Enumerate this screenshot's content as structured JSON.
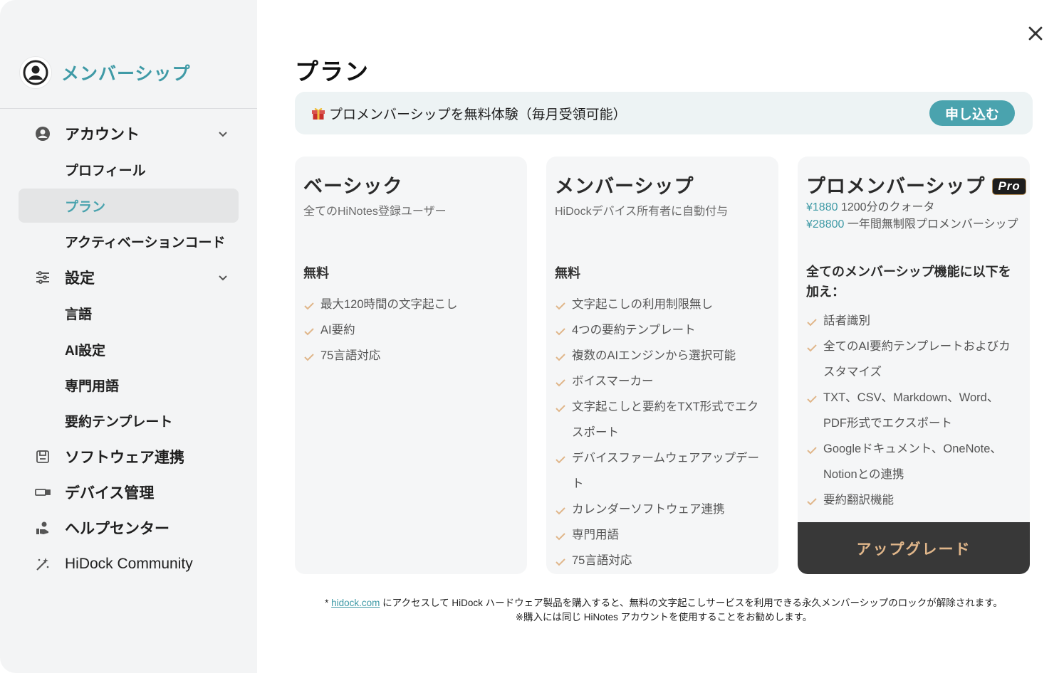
{
  "sidebar": {
    "title": "メンバーシップ",
    "items": [
      {
        "label": "アカウント"
      },
      {
        "label": "プロフィール"
      },
      {
        "label": "プラン"
      },
      {
        "label": "アクティベーションコード"
      },
      {
        "label": "設定"
      },
      {
        "label": "言語"
      },
      {
        "label": "AI設定"
      },
      {
        "label": "専門用語"
      },
      {
        "label": "要約テンプレート"
      },
      {
        "label": "ソフトウェア連携"
      },
      {
        "label": "デバイス管理"
      },
      {
        "label": "ヘルプセンター"
      },
      {
        "label": "HiDock Community"
      }
    ]
  },
  "main": {
    "title": "プラン",
    "banner": {
      "text": "プロメンバーシップを無料体験（毎月受領可能）",
      "button": "申し込む"
    },
    "plans": [
      {
        "name": "ベーシック",
        "subtitle": "全てのHiNotes登録ユーザー",
        "price": "無料",
        "features": [
          "最大120時間の文字起こし",
          "AI要約",
          "75言語対応"
        ]
      },
      {
        "name": "メンバーシップ",
        "subtitle": "HiDockデバイス所有者に自動付与",
        "price": "無料",
        "features": [
          "文字起こしの利用制限無し",
          "4つの要約テンプレート",
          "複数のAIエンジンから選択可能",
          "ボイスマーカー",
          "文字起こしと要約をTXT形式でエクスポート",
          "デバイスファームウェアアップデート",
          "カレンダーソフトウェア連携",
          "専門用語",
          "75言語対応"
        ]
      },
      {
        "name": "プロメンバーシップ",
        "badge": "Pro",
        "price1": "¥1880",
        "price1_desc": " 1200分のクォータ",
        "price2": "¥28800",
        "price2_desc": " 一年間無制限プロメンバーシップ",
        "lead": "全てのメンバーシップ機能に以下を加え：",
        "features": [
          "話者識別",
          "全てのAI要約テンプレートおよびカスタマイズ",
          "TXT、CSV、Markdown、Word、PDF形式でエクスポート",
          "Googleドキュメント、OneNote、Notionとの連携",
          "要約翻訳機能"
        ],
        "button": "アップグレード"
      }
    ],
    "footnote": {
      "prefix": "* ",
      "link": "hidock.com",
      "line1": " にアクセスして HiDock ハードウェア製品を購入すると、無料の文字起こしサービスを利用できる永久メンバーシップのロックが解除されます。",
      "line2": "※購入には同じ HiNotes アカウントを使用することをお勧めします。"
    }
  },
  "colors": {
    "accent": "#4aa3ae",
    "check": "#e0b68a",
    "upgrade_bg": "#383838"
  }
}
